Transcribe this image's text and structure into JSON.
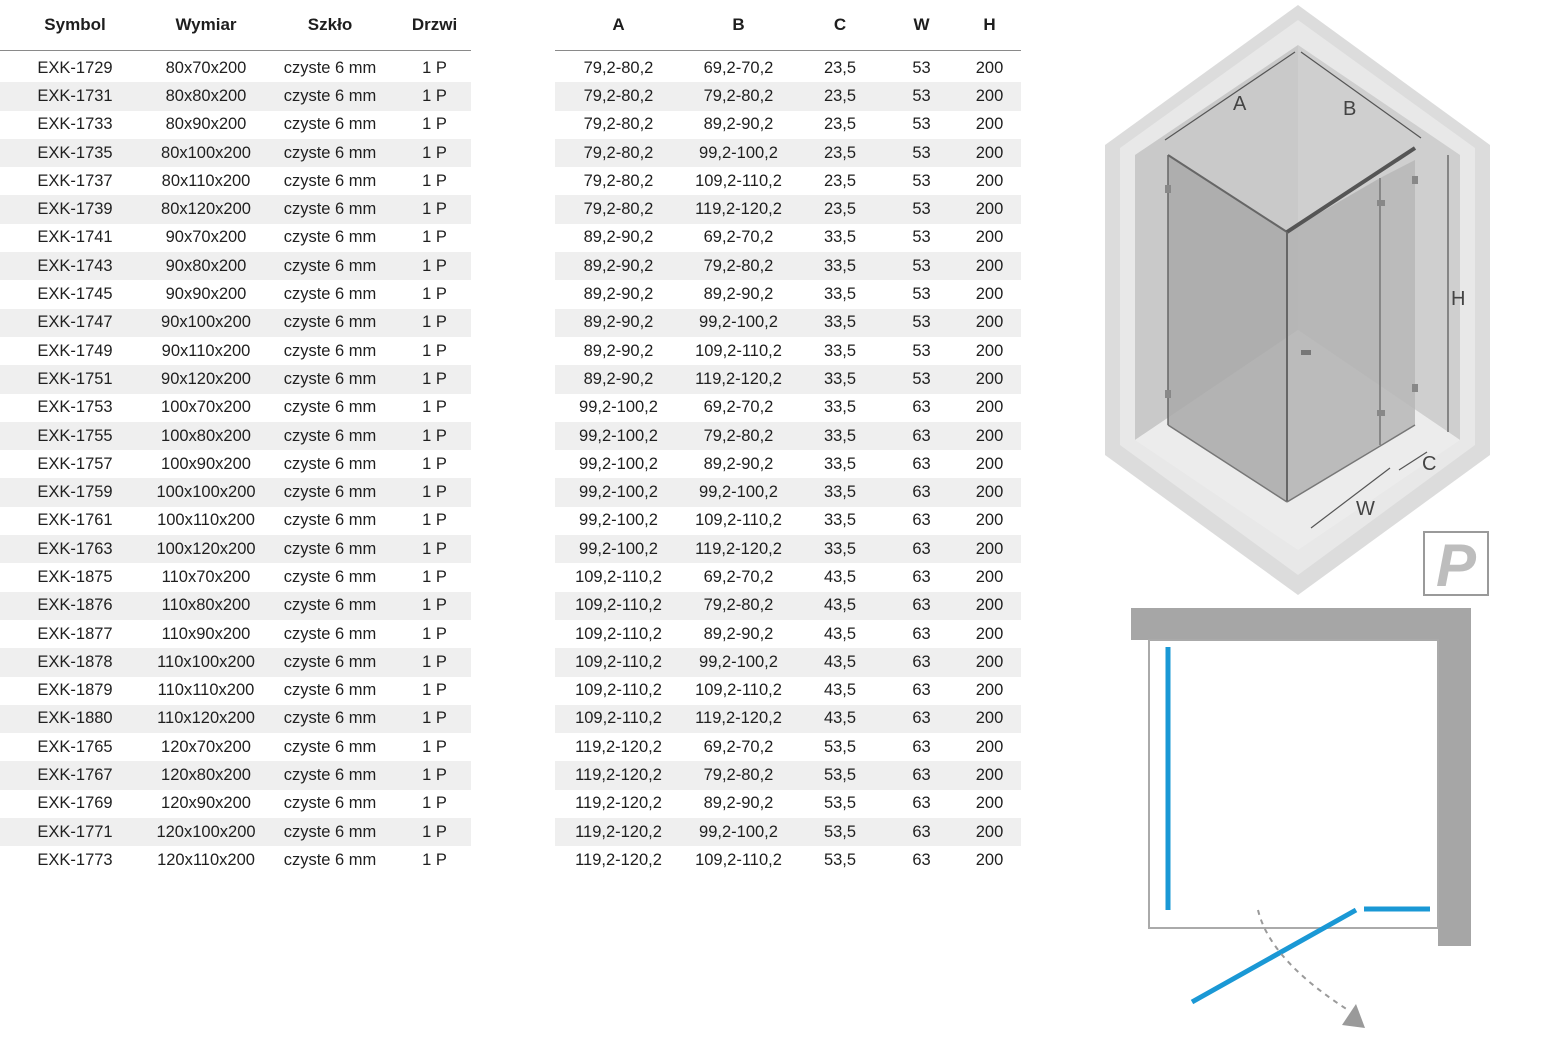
{
  "left_table": {
    "headers": [
      "Symbol",
      "Wymiar",
      "Szkło",
      "Drzwi"
    ],
    "rows": [
      [
        "EXK-1729",
        "80x70x200",
        "czyste 6 mm",
        "1 P"
      ],
      [
        "EXK-1731",
        "80x80x200",
        "czyste 6 mm",
        "1 P"
      ],
      [
        "EXK-1733",
        "80x90x200",
        "czyste 6 mm",
        "1 P"
      ],
      [
        "EXK-1735",
        "80x100x200",
        "czyste 6 mm",
        "1 P"
      ],
      [
        "EXK-1737",
        "80x110x200",
        "czyste 6 mm",
        "1 P"
      ],
      [
        "EXK-1739",
        "80x120x200",
        "czyste 6 mm",
        "1 P"
      ],
      [
        "EXK-1741",
        "90x70x200",
        "czyste 6 mm",
        "1 P"
      ],
      [
        "EXK-1743",
        "90x80x200",
        "czyste 6 mm",
        "1 P"
      ],
      [
        "EXK-1745",
        "90x90x200",
        "czyste 6 mm",
        "1 P"
      ],
      [
        "EXK-1747",
        "90x100x200",
        "czyste 6 mm",
        "1 P"
      ],
      [
        "EXK-1749",
        "90x110x200",
        "czyste 6 mm",
        "1 P"
      ],
      [
        "EXK-1751",
        "90x120x200",
        "czyste 6 mm",
        "1 P"
      ],
      [
        "EXK-1753",
        "100x70x200",
        "czyste 6 mm",
        "1 P"
      ],
      [
        "EXK-1755",
        "100x80x200",
        "czyste 6 mm",
        "1 P"
      ],
      [
        "EXK-1757",
        "100x90x200",
        "czyste 6 mm",
        "1 P"
      ],
      [
        "EXK-1759",
        "100x100x200",
        "czyste 6 mm",
        "1 P"
      ],
      [
        "EXK-1761",
        "100x110x200",
        "czyste 6 mm",
        "1 P"
      ],
      [
        "EXK-1763",
        "100x120x200",
        "czyste 6 mm",
        "1 P"
      ],
      [
        "EXK-1875",
        "110x70x200",
        "czyste 6 mm",
        "1 P"
      ],
      [
        "EXK-1876",
        "110x80x200",
        "czyste 6 mm",
        "1 P"
      ],
      [
        "EXK-1877",
        "110x90x200",
        "czyste 6 mm",
        "1 P"
      ],
      [
        "EXK-1878",
        "110x100x200",
        "czyste 6 mm",
        "1 P"
      ],
      [
        "EXK-1879",
        "110x110x200",
        "czyste 6 mm",
        "1 P"
      ],
      [
        "EXK-1880",
        "110x120x200",
        "czyste 6 mm",
        "1 P"
      ],
      [
        "EXK-1765",
        "120x70x200",
        "czyste 6 mm",
        "1 P"
      ],
      [
        "EXK-1767",
        "120x80x200",
        "czyste 6 mm",
        "1 P"
      ],
      [
        "EXK-1769",
        "120x90x200",
        "czyste 6 mm",
        "1 P"
      ],
      [
        "EXK-1771",
        "120x100x200",
        "czyste 6 mm",
        "1 P"
      ],
      [
        "EXK-1773",
        "120x110x200",
        "czyste 6 mm",
        "1 P"
      ]
    ]
  },
  "right_table": {
    "headers": [
      "A",
      "B",
      "C",
      "W",
      "H"
    ],
    "rows": [
      [
        "79,2-80,2",
        "69,2-70,2",
        "23,5",
        "53",
        "200"
      ],
      [
        "79,2-80,2",
        "79,2-80,2",
        "23,5",
        "53",
        "200"
      ],
      [
        "79,2-80,2",
        "89,2-90,2",
        "23,5",
        "53",
        "200"
      ],
      [
        "79,2-80,2",
        "99,2-100,2",
        "23,5",
        "53",
        "200"
      ],
      [
        "79,2-80,2",
        "109,2-110,2",
        "23,5",
        "53",
        "200"
      ],
      [
        "79,2-80,2",
        "119,2-120,2",
        "23,5",
        "53",
        "200"
      ],
      [
        "89,2-90,2",
        "69,2-70,2",
        "33,5",
        "53",
        "200"
      ],
      [
        "89,2-90,2",
        "79,2-80,2",
        "33,5",
        "53",
        "200"
      ],
      [
        "89,2-90,2",
        "89,2-90,2",
        "33,5",
        "53",
        "200"
      ],
      [
        "89,2-90,2",
        "99,2-100,2",
        "33,5",
        "53",
        "200"
      ],
      [
        "89,2-90,2",
        "109,2-110,2",
        "33,5",
        "53",
        "200"
      ],
      [
        "89,2-90,2",
        "119,2-120,2",
        "33,5",
        "53",
        "200"
      ],
      [
        "99,2-100,2",
        "69,2-70,2",
        "33,5",
        "63",
        "200"
      ],
      [
        "99,2-100,2",
        "79,2-80,2",
        "33,5",
        "63",
        "200"
      ],
      [
        "99,2-100,2",
        "89,2-90,2",
        "33,5",
        "63",
        "200"
      ],
      [
        "99,2-100,2",
        "99,2-100,2",
        "33,5",
        "63",
        "200"
      ],
      [
        "99,2-100,2",
        "109,2-110,2",
        "33,5",
        "63",
        "200"
      ],
      [
        "99,2-100,2",
        "119,2-120,2",
        "33,5",
        "63",
        "200"
      ],
      [
        "109,2-110,2",
        "69,2-70,2",
        "43,5",
        "63",
        "200"
      ],
      [
        "109,2-110,2",
        "79,2-80,2",
        "43,5",
        "63",
        "200"
      ],
      [
        "109,2-110,2",
        "89,2-90,2",
        "43,5",
        "63",
        "200"
      ],
      [
        "109,2-110,2",
        "99,2-100,2",
        "43,5",
        "63",
        "200"
      ],
      [
        "109,2-110,2",
        "109,2-110,2",
        "43,5",
        "63",
        "200"
      ],
      [
        "109,2-110,2",
        "119,2-120,2",
        "43,5",
        "63",
        "200"
      ],
      [
        "119,2-120,2",
        "69,2-70,2",
        "53,5",
        "63",
        "200"
      ],
      [
        "119,2-120,2",
        "79,2-80,2",
        "53,5",
        "63",
        "200"
      ],
      [
        "119,2-120,2",
        "89,2-90,2",
        "53,5",
        "63",
        "200"
      ],
      [
        "119,2-120,2",
        "99,2-100,2",
        "53,5",
        "63",
        "200"
      ],
      [
        "119,2-120,2",
        "109,2-110,2",
        "53,5",
        "63",
        "200"
      ]
    ]
  },
  "diagram": {
    "labels": {
      "a": "A",
      "b": "B",
      "c": "C",
      "w": "W",
      "h": "H"
    },
    "orientation_badge": "P",
    "colors": {
      "glass_line": "#1a98d5",
      "wall": "#a6a6a6",
      "floor": "#e3e3e3",
      "arrow": "#9a9a9a"
    }
  }
}
